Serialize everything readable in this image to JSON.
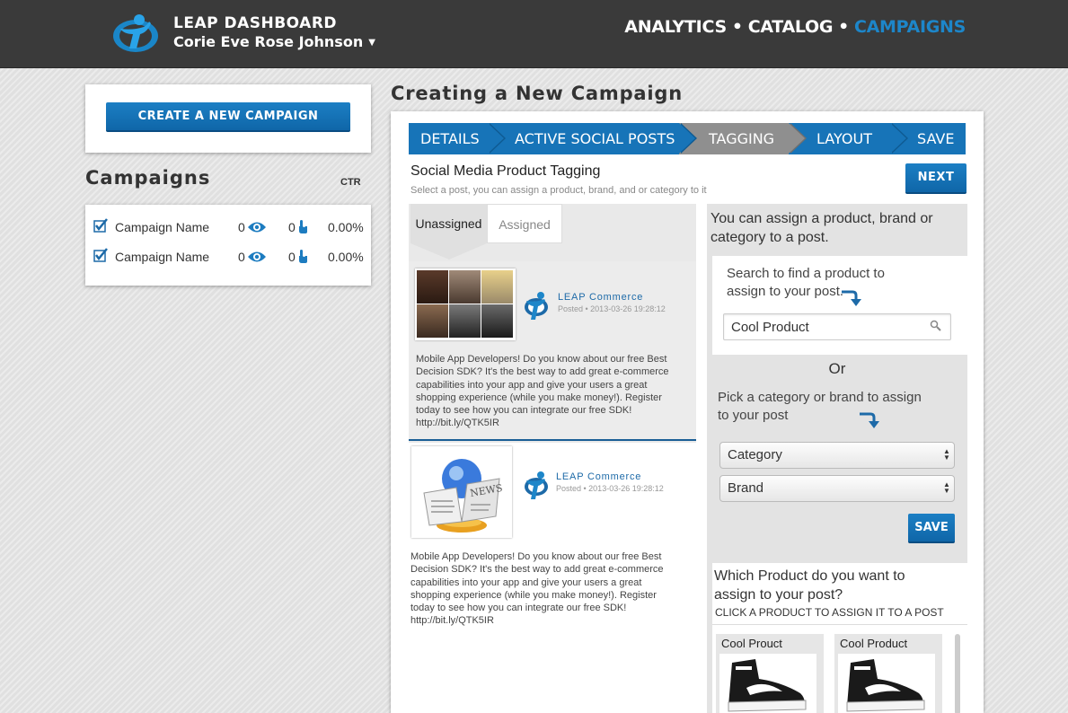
{
  "header": {
    "brand": "LEAP DASHBOARD",
    "user": "Corie Eve Rose Johnson",
    "nav": [
      "ANALYTICS",
      "CATALOG",
      "CAMPAIGNS"
    ],
    "nav_active": "CAMPAIGNS",
    "nav_separator": "•"
  },
  "sidebar": {
    "create_button": "CREATE A NEW CAMPAIGN",
    "heading": "Campaigns",
    "ctr_label": "CTR",
    "campaigns": [
      {
        "name": "Campaign Name",
        "views": "0",
        "clicks": "0",
        "ctr": "0.00%",
        "checked": true
      },
      {
        "name": "Campaign Name",
        "views": "0",
        "clicks": "0",
        "ctr": "0.00%",
        "checked": true
      }
    ]
  },
  "main": {
    "title": "Creating a New Campaign",
    "steps": [
      "DETAILS",
      "ACTIVE SOCIAL POSTS",
      "TAGGING",
      "LAYOUT",
      "SAVE"
    ],
    "active_step": "TAGGING",
    "section_title": "Social Media Product Tagging",
    "section_subtitle": "Select a post, you can assign a product, brand, and or category to it",
    "next_button": "NEXT",
    "tabs": [
      "Unassigned",
      "Assigned"
    ],
    "posts": [
      {
        "author": "LEAP Commerce",
        "meta": "Posted • 2013-03-26 19:28:12",
        "text": "Mobile App Developers! Do you know about our free Best Decision SDK? It's the best way to add great e-commerce capabilities into your app and give your users a great shopping experience (while you make money!). Register today to see how you can integrate our free SDK! http://bit.ly/QTK5IR"
      },
      {
        "author": "LEAP Commerce",
        "meta": "Posted • 2013-03-26 19:28:12",
        "text": "Mobile App Developers! Do you know about our free Best Decision SDK? It's the best way to add great e-commerce capabilities into your app and give your users a great shopping experience (while you make money!). Register today to see how you can integrate our free SDK! http://bit.ly/QTK5IR",
        "image_label": "NEWS"
      }
    ],
    "assign": {
      "title": "You can assign a product, brand or category to a post.",
      "search_hint": "Search to find a product to assign to your post.",
      "search_value": "Cool Product",
      "or": "Or",
      "pick_hint": "Pick a category or brand to assign to your post",
      "category": "Category",
      "brand": "Brand",
      "save": "SAVE",
      "which_title": "Which Product do you want to assign to your post?",
      "which_sub": "CLICK A PRODUCT TO ASSIGN IT TO A POST",
      "products": [
        "Cool Prouct",
        "Cool Product"
      ]
    }
  },
  "colors": {
    "topbar": "#3a3a3a",
    "accent_blue": "#1774b8",
    "nav_active": "#1d86c9",
    "step_active": "#8f8f8f"
  }
}
